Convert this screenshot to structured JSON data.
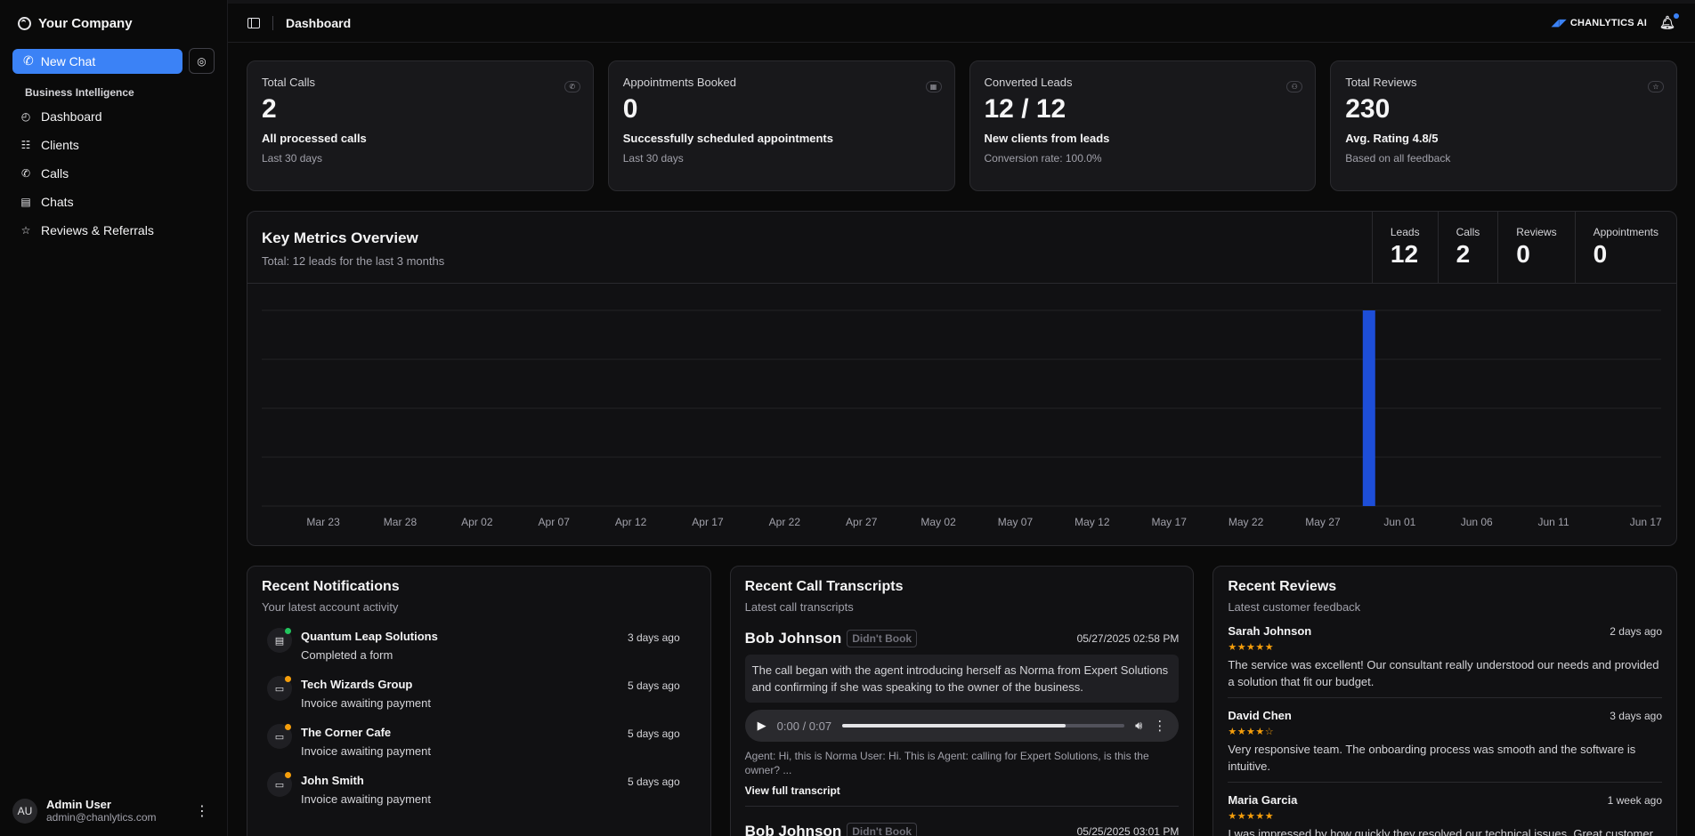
{
  "brand": {
    "company": "Your Company"
  },
  "sidebar": {
    "new_chat": "New Chat",
    "section": "Business Intelligence",
    "items": [
      {
        "label": "Dashboard",
        "icon": "gauge-icon"
      },
      {
        "label": "Clients",
        "icon": "list-icon"
      },
      {
        "label": "Calls",
        "icon": "phone-icon"
      },
      {
        "label": "Chats",
        "icon": "message-icon"
      },
      {
        "label": "Reviews & Referrals",
        "icon": "star-icon"
      }
    ],
    "user": {
      "initials": "AU",
      "name": "Admin User",
      "email": "admin@chanlytics.com"
    }
  },
  "topbar": {
    "title": "Dashboard",
    "brand": "CHANLYTICS AI"
  },
  "cards": [
    {
      "title": "Total Calls",
      "value": "2",
      "sub": "All processed calls",
      "note": "Last 30 days",
      "icon": "phone-icon"
    },
    {
      "title": "Appointments Booked",
      "value": "0",
      "sub": "Successfully scheduled appointments",
      "note": "Last 30 days",
      "icon": "calendar-icon"
    },
    {
      "title": "Converted Leads",
      "value": "12 / 12",
      "sub": "New clients from leads",
      "note": "Conversion rate: 100.0%",
      "icon": "users-icon"
    },
    {
      "title": "Total Reviews",
      "value": "230",
      "sub": "Avg. Rating 4.8/5",
      "note": "Based on all feedback",
      "icon": "star-icon"
    }
  ],
  "metrics": {
    "title": "Key Metrics Overview",
    "subtitle": "Total: 12 leads for the last 3 months",
    "kpis": [
      {
        "label": "Leads",
        "value": "12"
      },
      {
        "label": "Calls",
        "value": "2"
      },
      {
        "label": "Reviews",
        "value": "0"
      },
      {
        "label": "Appointments",
        "value": "0"
      }
    ]
  },
  "chart_data": {
    "type": "bar",
    "tick_labels": [
      "Mar 23",
      "Mar 28",
      "Apr 02",
      "Apr 07",
      "Apr 12",
      "Apr 17",
      "Apr 22",
      "Apr 27",
      "May 02",
      "May 07",
      "May 12",
      "May 17",
      "May 22",
      "May 27",
      "Jun 01",
      "Jun 06",
      "Jun 11",
      "Jun 17"
    ],
    "x_range": [
      "Mar 19",
      "Jun 18"
    ],
    "bars": [
      {
        "x": "May 30",
        "value": 12
      }
    ],
    "ylim": [
      0,
      12
    ],
    "grid": true,
    "color": "#1d4ed8"
  },
  "notifications": {
    "title": "Recent Notifications",
    "subtitle": "Your latest account activity",
    "items": [
      {
        "name": "Quantum Leap Solutions",
        "desc": "Completed a form",
        "time": "3 days ago",
        "dot": "#22c55e",
        "icon": "document-icon"
      },
      {
        "name": "Tech Wizards Group",
        "desc": "Invoice awaiting payment",
        "time": "5 days ago",
        "dot": "#f59e0b",
        "icon": "card-icon"
      },
      {
        "name": "The Corner Cafe",
        "desc": "Invoice awaiting payment",
        "time": "5 days ago",
        "dot": "#f59e0b",
        "icon": "card-icon"
      },
      {
        "name": "John Smith",
        "desc": "Invoice awaiting payment",
        "time": "5 days ago",
        "dot": "#f59e0b",
        "icon": "card-icon"
      }
    ]
  },
  "calls": {
    "title": "Recent Call Transcripts",
    "subtitle": "Latest call transcripts",
    "items": [
      {
        "name": "Bob Johnson",
        "badge": "Didn't Book",
        "date": "05/27/2025 02:58 PM",
        "summary": "The call began with the agent introducing herself as Norma from Expert Solutions and confirming if she was speaking to the owner of the business.",
        "player_time": "0:00 / 0:07",
        "progress": 0.79,
        "snippet": "Agent: Hi, this is Norma User: Hi. This is Agent: calling for Expert Solutions, is this the owner? ...",
        "link": "View full transcript"
      },
      {
        "name": "Bob Johnson",
        "badge": "Didn't Book",
        "date": "05/25/2025 03:01 PM"
      }
    ]
  },
  "reviews": {
    "title": "Recent Reviews",
    "subtitle": "Latest customer feedback",
    "items": [
      {
        "name": "Sarah Johnson",
        "time": "2 days ago",
        "rating": 5,
        "stars": "★★★★★",
        "text": "The service was excellent! Our consultant really understood our needs and provided a solution that fit our budget."
      },
      {
        "name": "David Chen",
        "time": "3 days ago",
        "rating": 4,
        "stars": "★★★★☆",
        "text": "Very responsive team. The onboarding process was smooth and the software is intuitive."
      },
      {
        "name": "Maria Garcia",
        "time": "1 week ago",
        "rating": 5,
        "stars": "★★★★★",
        "text": "I was impressed by how quickly they resolved our technical issues. Great customer service!"
      }
    ]
  }
}
